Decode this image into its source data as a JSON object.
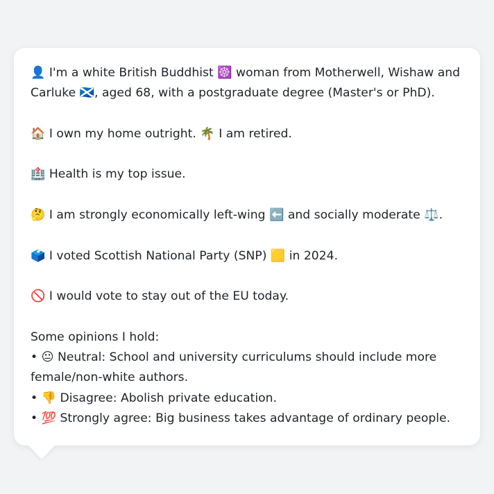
{
  "profile": {
    "intro": "👤 I'm a white British Buddhist ☸️ woman from Motherwell, Wishaw and Carluke 🏴󠁧󠁢󠁳󠁣󠁴󠁿, aged 68, with a postgraduate degree (Master's or PhD).",
    "home": "🏠 I own my home outright. 🌴 I am retired.",
    "issue": "🏥 Health is my top issue.",
    "ideology": "🤔 I am strongly economically left-wing ⬅️ and socially moderate ⚖️.",
    "vote": "🗳️ I voted Scottish National Party (SNP) 🟨 in 2024.",
    "eu": "🚫 I would vote to stay out of the EU today.",
    "opinions_heading": "Some opinions I hold:",
    "opinions": [
      "• 😐 Neutral: School and university curriculums should include more female/non-white authors.",
      "• 👎 Disagree: Abolish private education.",
      "• 💯 Strongly agree: Big business takes advantage of ordinary people."
    ]
  }
}
